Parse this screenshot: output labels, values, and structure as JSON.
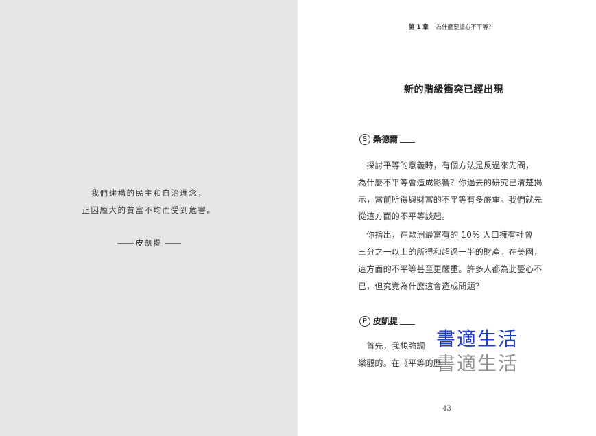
{
  "left_page": {
    "quote": [
      "我們建構的民主和自治理念，",
      "正因龐大的貧富不均而受到危害。"
    ],
    "author": "皮凱提"
  },
  "right_page": {
    "running_head": {
      "chapter": "第 1 章",
      "title": "為什麼要擔心不平等？"
    },
    "section_title": "新的階級衝突已經出現",
    "speakers": [
      {
        "initial": "S",
        "name": "桑德爾"
      },
      {
        "initial": "P",
        "name": "皮凱提"
      }
    ],
    "paragraph_1": [
      "　探討平等的意義時，有個方法是反過來先問，",
      "為什麼不平等會造成影響？你過去的研究已清楚揭",
      "示，當前所得與財富的不平等有多嚴重。我們就先",
      "從這方面的不平等談起。"
    ],
    "paragraph_2": [
      "　你指出，在歐洲最富有的 10% 人口擁有社會",
      "三分之一以上的所得和超過一半的財產。在美國，",
      "這方面的不平等甚至更嚴重。許多人都為此憂心不",
      "已，但究竟為什麼這會造成問題？"
    ],
    "paragraph_3": [
      "　首先，我想強調",
      "樂觀的。在《平等的歷"
    ],
    "page_number": "43"
  },
  "watermark": {
    "text": "書適生活",
    "color": "#1d3fd8"
  }
}
